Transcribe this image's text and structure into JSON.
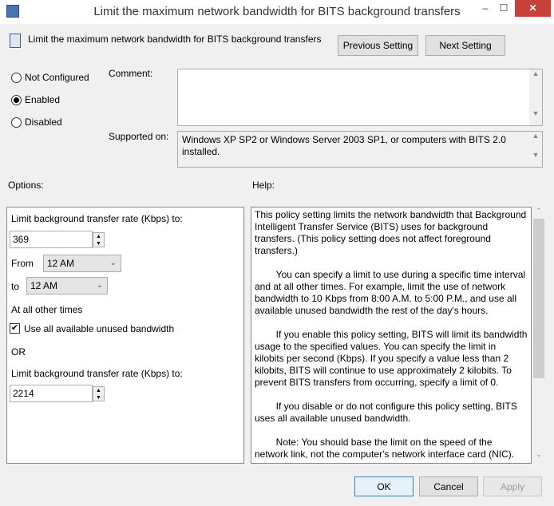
{
  "window": {
    "title": "Limit the maximum network bandwidth for BITS background transfers",
    "minimize": "–",
    "maximize": "☐",
    "close": "✕"
  },
  "header": {
    "setting_name": "Limit the maximum network bandwidth for BITS background transfers",
    "previous": "Previous Setting",
    "next": "Next Setting"
  },
  "state": {
    "not_configured": "Not Configured",
    "enabled": "Enabled",
    "disabled": "Disabled",
    "selected": "enabled"
  },
  "comment": {
    "label": "Comment:",
    "value": ""
  },
  "supported": {
    "label": "Supported on:",
    "value": "Windows XP SP2 or Windows Server 2003 SP1, or computers with BITS 2.0 installed."
  },
  "options": {
    "label": "Options:",
    "rate_label": "Limit background transfer rate (Kbps) to:",
    "rate_value": "369",
    "from_label": "From",
    "from_value": "12 AM",
    "to_label": "to",
    "to_value": "12 AM",
    "other_times": "At all other times",
    "use_all_label": "Use all available unused bandwidth",
    "use_all_checked": true,
    "or": "OR",
    "rate2_label": "Limit background transfer rate (Kbps) to:",
    "rate2_value": "2214"
  },
  "help": {
    "label": "Help:",
    "text": "This policy setting limits the network bandwidth that Background Intelligent Transfer Service (BITS) uses for background transfers. (This policy setting does not affect foreground transfers.)\n\n        You can specify a limit to use during a specific time interval and at all other times. For example, limit the use of network bandwidth to 10 Kbps from 8:00 A.M. to 5:00 P.M., and use all available unused bandwidth the rest of the day's hours.\n\n        If you enable this policy setting, BITS will limit its bandwidth usage to the specified values. You can specify the limit in kilobits per second (Kbps). If you specify a value less than 2 kilobits, BITS will continue to use approximately 2 kilobits. To prevent BITS transfers from occurring, specify a limit of 0.\n\n        If you disable or do not configure this policy setting, BITS uses all available unused bandwidth.\n\n        Note: You should base the limit on the speed of the network link, not the computer's network interface card (NIC)."
  },
  "footer": {
    "ok": "OK",
    "cancel": "Cancel",
    "apply": "Apply"
  }
}
